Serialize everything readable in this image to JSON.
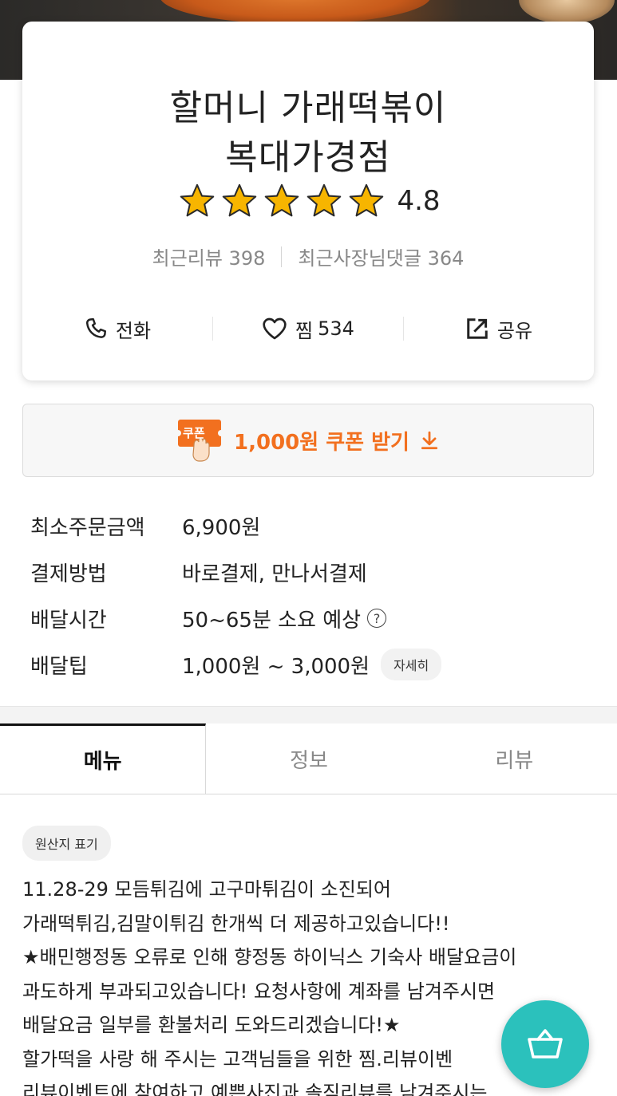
{
  "store": {
    "name_line1": "할머니 가래떡볶이",
    "name_line2": "복대가경점",
    "rating": "4.8",
    "stars": 5,
    "recent_reviews_label": "최근리뷰 398",
    "owner_replies_label": "최근사장님댓글 364"
  },
  "actions": {
    "call_label": "전화",
    "favorite_label": "찜",
    "favorite_count": "534",
    "share_label": "공유"
  },
  "coupon": {
    "badge_text": "쿠폰",
    "label": "1,000원 쿠폰 받기"
  },
  "info": {
    "min_order_label": "최소주문금액",
    "min_order_value": "6,900원",
    "payment_label": "결제방법",
    "payment_value": "바로결제, 만나서결제",
    "delivery_time_label": "배달시간",
    "delivery_time_value": "50~65분 소요 예상",
    "tip_label": "배달팁",
    "tip_value": "1,000원 ~ 3,000원",
    "detail_button": "자세히"
  },
  "tabs": [
    "메뉴",
    "정보",
    "리뷰"
  ],
  "origin_chip": "원산지 표기",
  "notice_lines": [
    "11.28-29 모듬튀김에 고구마튀김이 소진되어",
    "가래떡튀김,김말이튀김 한개씩 더 제공하고있습니다!!",
    "★배민행정동 오류로 인해 향정동 하이닉스 기숙사 배달요금이",
    "과도하게 부과되고있습니다! 요청사항에 계좌를 남겨주시면",
    "배달요금 일부를 환불처리 도와드리겠습니다!★",
    "할가떡을 사랑 해 주시는 고객님들을 위한 찜.리뷰이벤",
    "리뷰이벤트에 참여하고 예쁜사진과 솔직리뷰를 남겨주시는"
  ],
  "colors": {
    "coupon_orange": "#f2701f",
    "cart_teal": "#2bc1bc",
    "star_gold": "#f7b500"
  },
  "icons": [
    "phone-icon",
    "heart-icon",
    "share-icon",
    "star-icon",
    "download-icon",
    "question-icon",
    "cart-icon"
  ]
}
